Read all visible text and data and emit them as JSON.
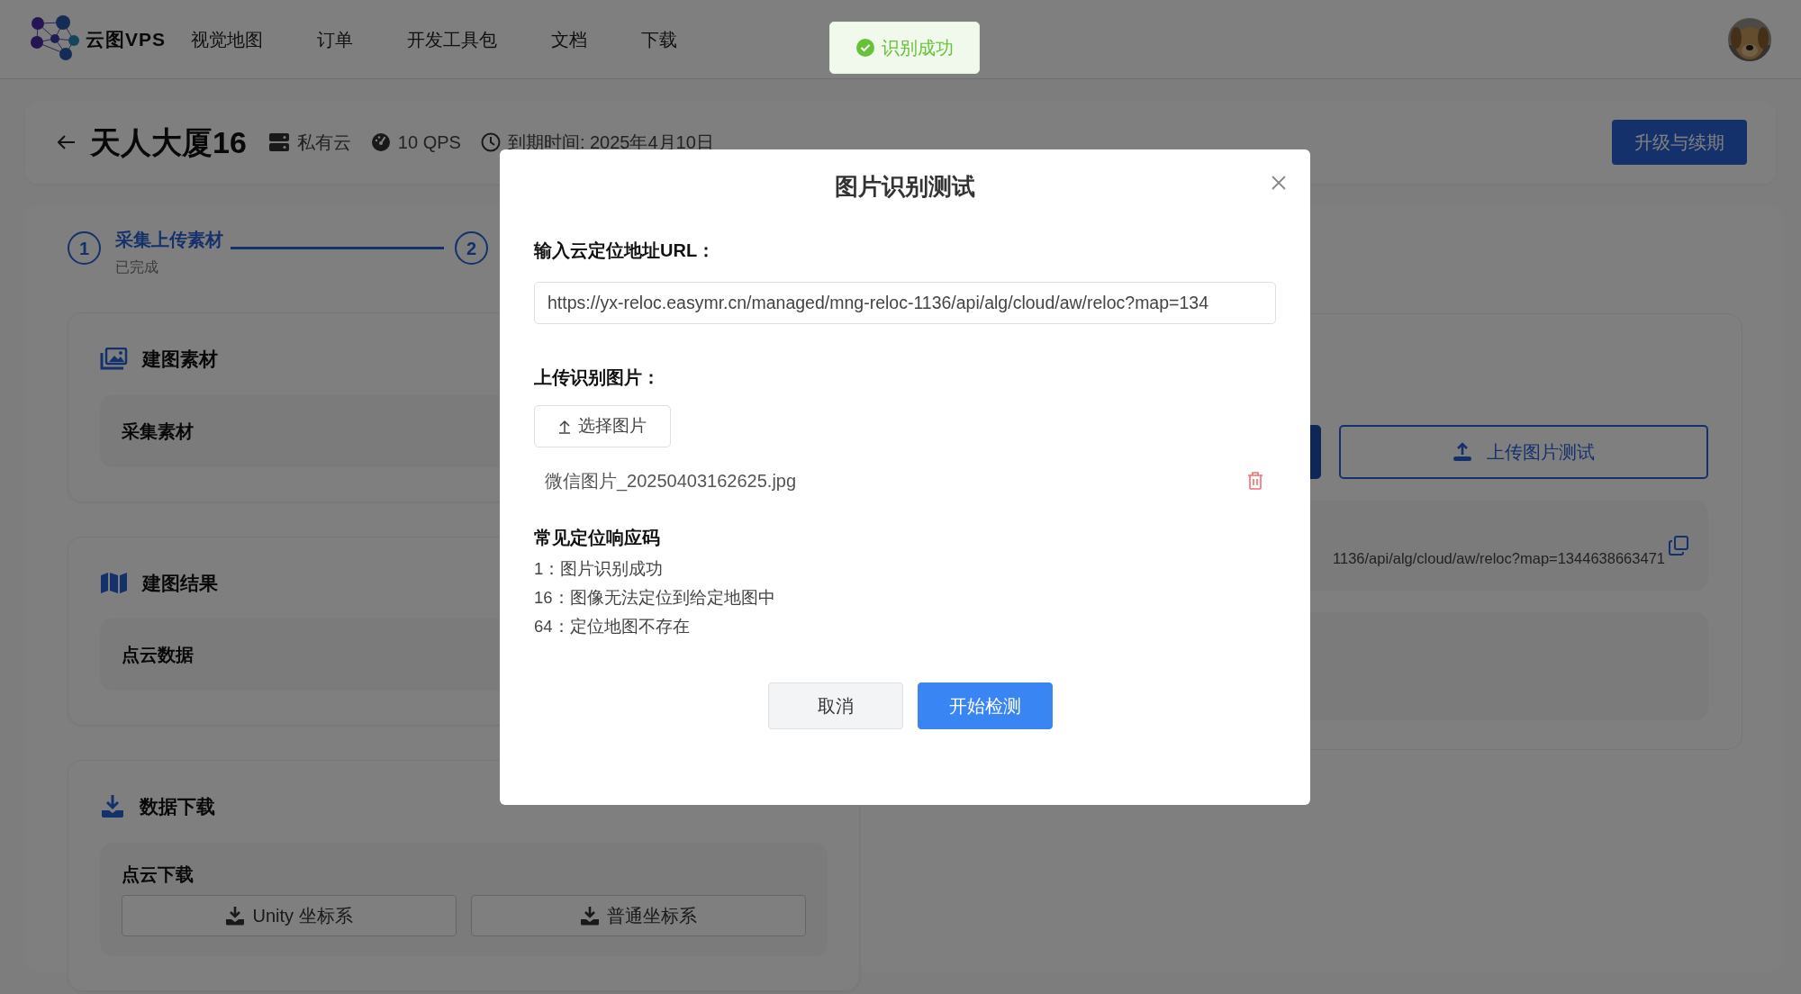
{
  "navbar": {
    "brand": "云图VPS",
    "items": [
      {
        "label": "视觉地图"
      },
      {
        "label": "订单"
      },
      {
        "label": "开发工具包"
      },
      {
        "label": "文档"
      },
      {
        "label": "下载"
      }
    ]
  },
  "toast": {
    "kind": "success",
    "message": "识别成功"
  },
  "header": {
    "title": "天人大厦16",
    "meta": [
      {
        "kind": "server",
        "text": "私有云"
      },
      {
        "kind": "gauge",
        "text": "10 QPS"
      },
      {
        "kind": "clock",
        "text": "到期时间: 2025年4月10日"
      }
    ],
    "action": "升级与续期"
  },
  "steps": [
    {
      "number": "1",
      "title": "采集上传素材",
      "description": "已完成"
    },
    {
      "number": "2"
    }
  ],
  "sections": [
    {
      "kind": "images",
      "title": "建图素材",
      "items": [
        {
          "label": "采集素材"
        }
      ]
    },
    {
      "kind": "map",
      "title": "建图结果",
      "items": [
        {
          "label": "点云数据"
        }
      ]
    },
    {
      "kind": "download",
      "title": "数据下载",
      "items": [
        {
          "label": "点云下载",
          "buttons": [
            "Unity 坐标系",
            "普通坐标系"
          ]
        }
      ]
    }
  ],
  "right_panel": {
    "upload_button": "上传图片测试",
    "url": "1136/api/alg/cloud/aw/reloc?map=1344638663471"
  },
  "modal": {
    "title": "图片识别测试",
    "url_label": "输入云定位地址URL：",
    "url_value": "https://yx-reloc.easymr.cn/managed/mng-reloc-1136/api/alg/cloud/aw/reloc?map=134",
    "upload_label": "上传识别图片：",
    "upload_button": "选择图片",
    "files": [
      {
        "name": "微信图片_20250403162625.jpg"
      }
    ],
    "codes_title": "常见定位响应码",
    "codes": [
      "1：图片识别成功",
      "16：图像无法定位到给定地图中",
      "64：定位地图不存在"
    ],
    "buttons": [
      {
        "label": "取消",
        "kind": "secondary"
      },
      {
        "label": "开始检测",
        "kind": "primary"
      }
    ]
  }
}
